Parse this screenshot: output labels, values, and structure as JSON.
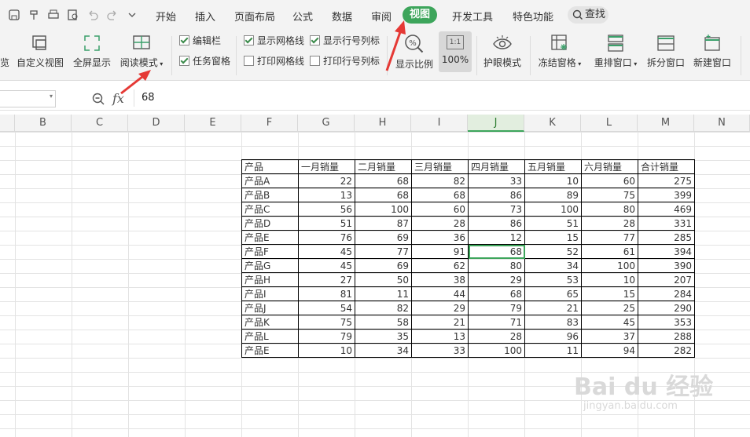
{
  "menu": {
    "tabs": [
      "开始",
      "插入",
      "页面布局",
      "公式",
      "数据",
      "审阅"
    ],
    "active_tab": "视图",
    "tabs_after": [
      "开发工具",
      "特色功能"
    ],
    "search_label": "查找"
  },
  "ribbon": {
    "cut_label": "览",
    "custom_view": "自定义视图",
    "fullscreen": "全屏显示",
    "reading_mode": "阅读模式",
    "checks": [
      {
        "label": "编辑栏",
        "checked": true
      },
      {
        "label": "任务窗格",
        "checked": true
      },
      {
        "label": "显示网格线",
        "checked": true
      },
      {
        "label": "打印网格线",
        "checked": false
      },
      {
        "label": "显示行号列标",
        "checked": true
      },
      {
        "label": "打印行号列标",
        "checked": false
      }
    ],
    "zoom_ratio": "显示比例",
    "zoom_100": "100%",
    "zoom_box": "1:1",
    "eye_mode": "护眼模式",
    "freeze": "冻结窗格",
    "rearrange": "重排窗口",
    "split": "拆分窗口",
    "new_window": "新建窗口"
  },
  "formula_bar": {
    "fx": "fx",
    "value": "68"
  },
  "columns": [
    "B",
    "C",
    "D",
    "E",
    "F",
    "G",
    "H",
    "I",
    "J",
    "K",
    "L",
    "M",
    "N"
  ],
  "selected_column": "J",
  "table": {
    "headers": [
      "产品",
      "一月销量",
      "二月销量",
      "三月销量",
      "四月销量",
      "五月销量",
      "六月销量",
      "合计销量"
    ],
    "rows": [
      [
        "产品A",
        "22",
        "68",
        "82",
        "33",
        "10",
        "60",
        "275"
      ],
      [
        "产品B",
        "13",
        "68",
        "68",
        "86",
        "89",
        "75",
        "399"
      ],
      [
        "产品C",
        "56",
        "100",
        "60",
        "73",
        "100",
        "80",
        "469"
      ],
      [
        "产品D",
        "51",
        "87",
        "28",
        "86",
        "51",
        "28",
        "331"
      ],
      [
        "产品E",
        "76",
        "69",
        "36",
        "12",
        "15",
        "77",
        "285"
      ],
      [
        "产品F",
        "45",
        "77",
        "91",
        "68",
        "52",
        "61",
        "394"
      ],
      [
        "产品G",
        "45",
        "69",
        "62",
        "80",
        "34",
        "100",
        "390"
      ],
      [
        "产品H",
        "27",
        "50",
        "38",
        "29",
        "53",
        "10",
        "207"
      ],
      [
        "产品I",
        "81",
        "11",
        "44",
        "68",
        "65",
        "15",
        "284"
      ],
      [
        "产品J",
        "54",
        "82",
        "29",
        "79",
        "21",
        "25",
        "290"
      ],
      [
        "产品K",
        "75",
        "58",
        "21",
        "71",
        "83",
        "45",
        "353"
      ],
      [
        "产品L",
        "79",
        "35",
        "13",
        "28",
        "96",
        "37",
        "288"
      ],
      [
        "产品E",
        "10",
        "34",
        "33",
        "100",
        "11",
        "94",
        "282"
      ]
    ]
  },
  "watermark": {
    "text": "Bai du 经验",
    "sub": "jingyan.baidu.com"
  },
  "colors": {
    "accent": "#3da55b",
    "arrow": "#e53935"
  }
}
